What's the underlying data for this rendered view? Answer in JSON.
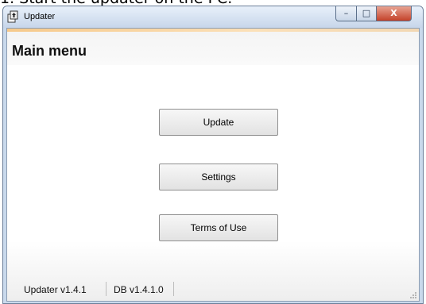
{
  "caption": "1. Start the updater on the PC.",
  "window": {
    "title": "Updater",
    "controls": {
      "minimize": "–",
      "maximize": "□",
      "close": "X"
    }
  },
  "header": {
    "title": "Main menu"
  },
  "menu": {
    "update": "Update",
    "settings": "Settings",
    "terms": "Terms of Use"
  },
  "status": {
    "app_version": "Updater v1.4.1",
    "db_version": "DB v1.4.1.0"
  },
  "colors": {
    "accent": "#f6c98b",
    "title_bar": "#c7d6ea",
    "close_button": "#c4422a"
  },
  "icons": [
    "updater-app-icon",
    "minimize-icon",
    "maximize-icon",
    "close-icon",
    "resize-grip-icon"
  ]
}
